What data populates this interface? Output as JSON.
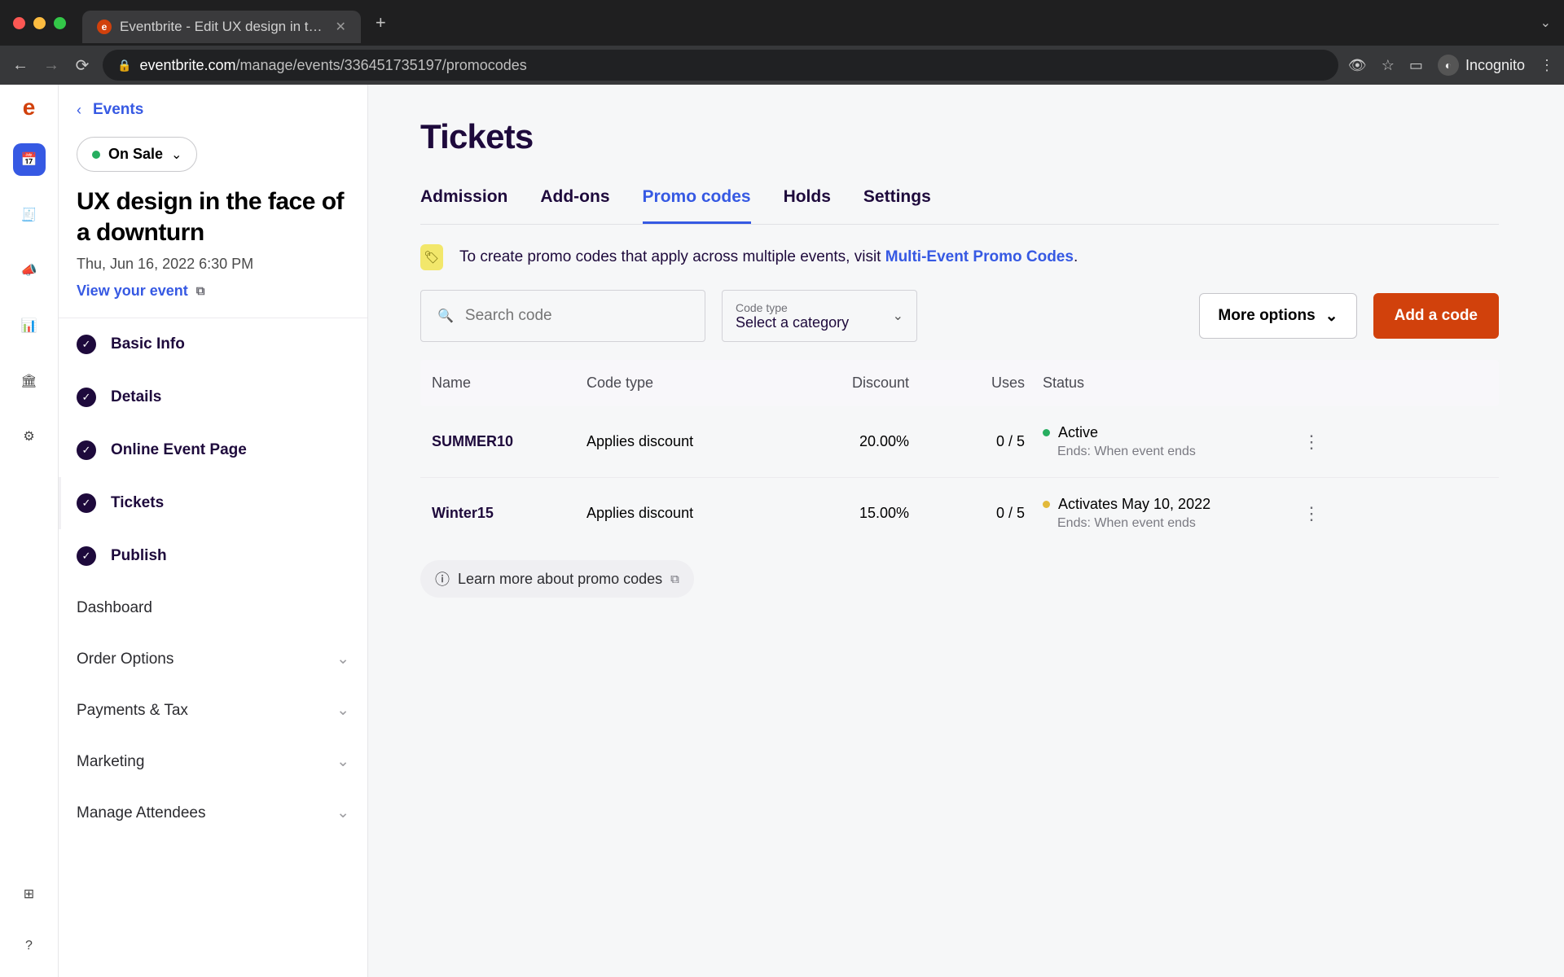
{
  "browser": {
    "tab_title": "Eventbrite - Edit UX design in t…",
    "url_host": "eventbrite.com",
    "url_path": "/manage/events/336451735197/promocodes",
    "incognito_label": "Incognito"
  },
  "sidebar": {
    "back_label": "Events",
    "status_label": "On Sale",
    "event_title": "UX design in the face of a downturn",
    "event_date": "Thu, Jun 16, 2022 6:30 PM",
    "view_event": "View your event",
    "steps": [
      {
        "label": "Basic Info"
      },
      {
        "label": "Details"
      },
      {
        "label": "Online Event Page"
      },
      {
        "label": "Tickets",
        "active": true
      },
      {
        "label": "Publish"
      }
    ],
    "sections": [
      {
        "label": "Dashboard",
        "expandable": false
      },
      {
        "label": "Order Options",
        "expandable": true
      },
      {
        "label": "Payments & Tax",
        "expandable": true
      },
      {
        "label": "Marketing",
        "expandable": true
      },
      {
        "label": "Manage Attendees",
        "expandable": true
      }
    ]
  },
  "page": {
    "title": "Tickets",
    "tabs": [
      {
        "label": "Admission"
      },
      {
        "label": "Add-ons"
      },
      {
        "label": "Promo codes",
        "active": true
      },
      {
        "label": "Holds"
      },
      {
        "label": "Settings"
      }
    ],
    "banner_text_prefix": "To create promo codes that apply across multiple events, visit ",
    "banner_link": "Multi-Event Promo Codes",
    "banner_suffix": ".",
    "search_placeholder": "Search code",
    "code_type_small": "Code type",
    "code_type_value": "Select a category",
    "more_options": "More options",
    "add_code": "Add a code",
    "learn_more": "Learn more about promo codes"
  },
  "table": {
    "headers": {
      "name": "Name",
      "code_type": "Code type",
      "discount": "Discount",
      "uses": "Uses",
      "status": "Status"
    },
    "rows": [
      {
        "name": "SUMMER10",
        "code_type": "Applies discount",
        "discount": "20.00%",
        "uses": "0 / 5",
        "status": "Active",
        "status_color": "green",
        "ends": "Ends: When event ends"
      },
      {
        "name": "Winter15",
        "code_type": "Applies discount",
        "discount": "15.00%",
        "uses": "0 / 5",
        "status": "Activates May 10, 2022",
        "status_color": "yellow",
        "ends": "Ends: When event ends"
      }
    ]
  }
}
